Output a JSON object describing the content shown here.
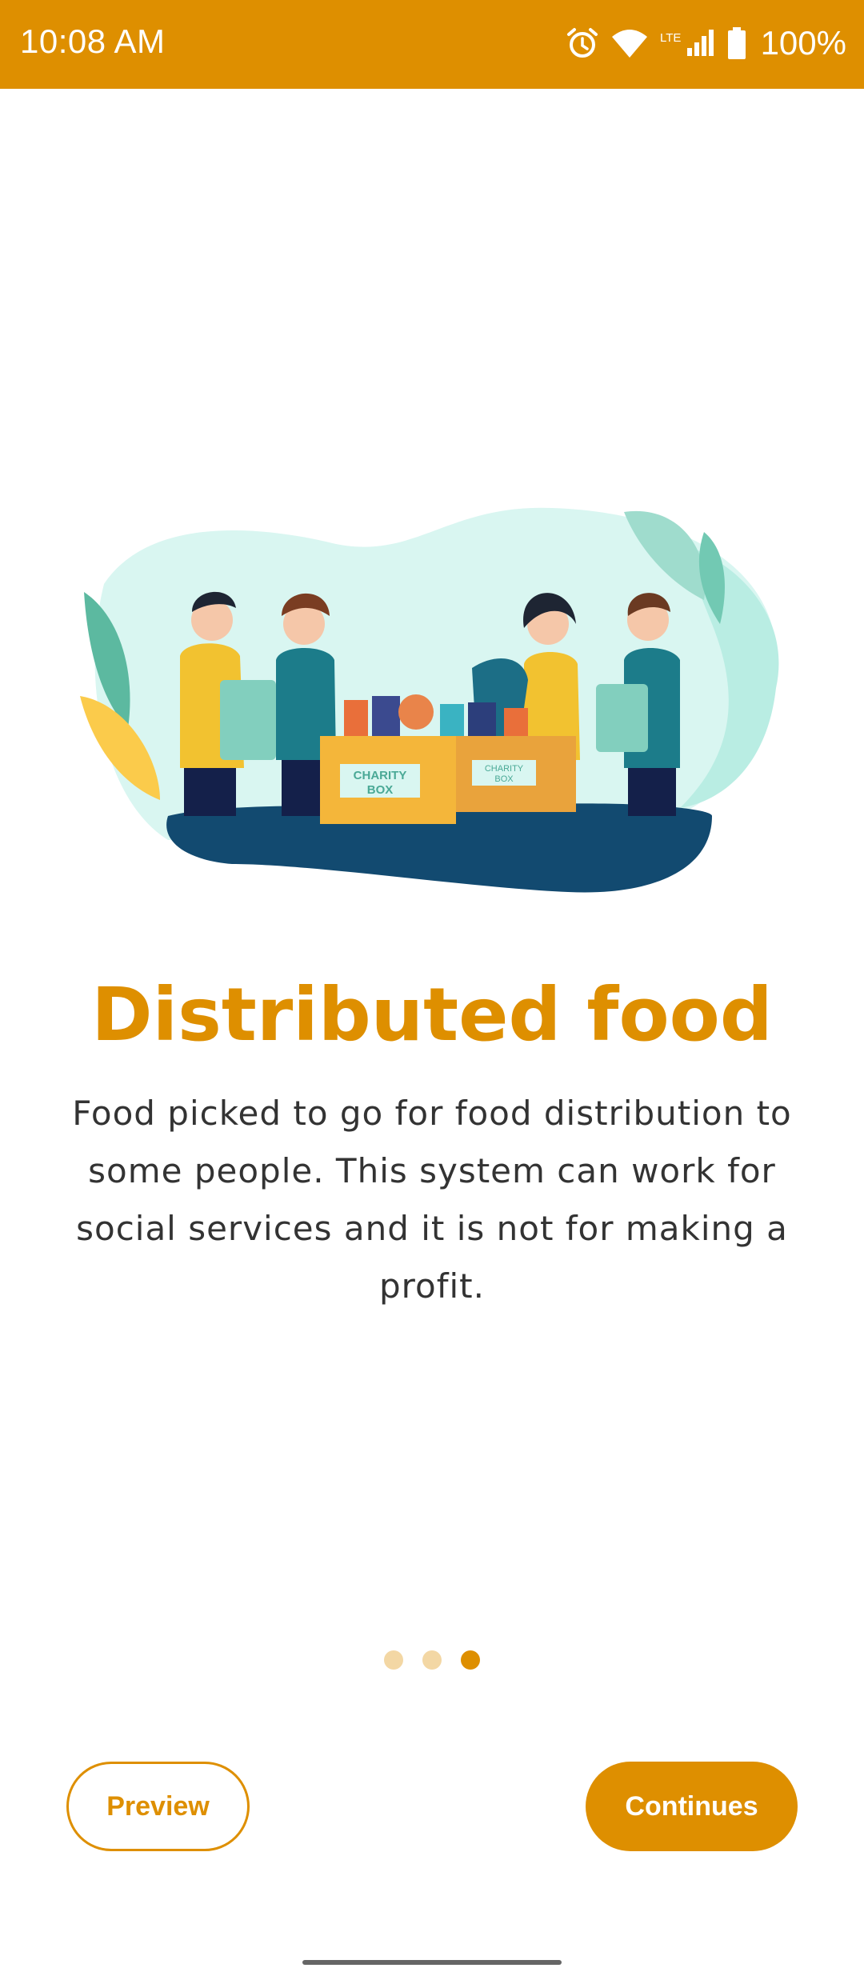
{
  "status_bar": {
    "time": "10:08 AM",
    "battery": "100%",
    "icons": [
      "alarm-icon",
      "wifi-icon",
      "lte-signal-icon",
      "battery-icon"
    ],
    "lte_label": "LTE"
  },
  "onboarding": {
    "title": "Distributed food",
    "description": "Food picked to go for food distribution to some people. This system can work for social services and it is not for making a profit.",
    "page_count": 3,
    "active_page": 3,
    "illustration": {
      "box_label_1": "CHARITY BOX",
      "box_label_2": "CHARITY BOX"
    }
  },
  "actions": {
    "preview_label": "Preview",
    "continue_label": "Continues"
  },
  "colors": {
    "accent": "#DE8F00",
    "dot_inactive": "#F3D7A4",
    "text": "#333333"
  }
}
